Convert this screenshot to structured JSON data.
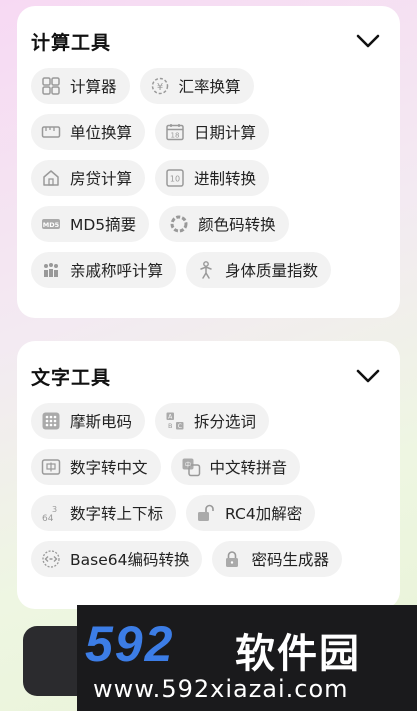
{
  "sections": [
    {
      "title": "计算工具",
      "rows": [
        [
          {
            "label": "计算器",
            "icon": "calculator-icon"
          },
          {
            "label": "汇率换算",
            "icon": "currency-icon"
          }
        ],
        [
          {
            "label": "单位换算",
            "icon": "ruler-icon"
          },
          {
            "label": "日期计算",
            "icon": "calendar-icon"
          }
        ],
        [
          {
            "label": "房贷计算",
            "icon": "house-icon"
          },
          {
            "label": "进制转换",
            "icon": "binary-icon"
          }
        ],
        [
          {
            "label": "MD5摘要",
            "icon": "md5-icon"
          },
          {
            "label": "颜色码转换",
            "icon": "color-wheel-icon"
          }
        ],
        [
          {
            "label": "亲戚称呼计算",
            "icon": "people-icon"
          },
          {
            "label": "身体质量指数",
            "icon": "body-icon"
          }
        ]
      ]
    },
    {
      "title": "文字工具",
      "rows": [
        [
          {
            "label": "摩斯电码",
            "icon": "keypad-icon"
          },
          {
            "label": "拆分选词",
            "icon": "letters-icon"
          }
        ],
        [
          {
            "label": "数字转中文",
            "icon": "chinese-char-icon"
          },
          {
            "label": "中文转拼音",
            "icon": "pinyin-icon"
          }
        ],
        [
          {
            "label": "数字转上下标",
            "icon": "superscript-icon"
          },
          {
            "label": "RC4加解密",
            "icon": "unlock-icon"
          }
        ],
        [
          {
            "label": "Base64编码转换",
            "icon": "code-icon"
          },
          {
            "label": "密码生成器",
            "icon": "lock-icon"
          }
        ]
      ]
    }
  ],
  "watermark": {
    "number": "592",
    "brand": "软件园",
    "url": "www.592xiazai.com"
  }
}
